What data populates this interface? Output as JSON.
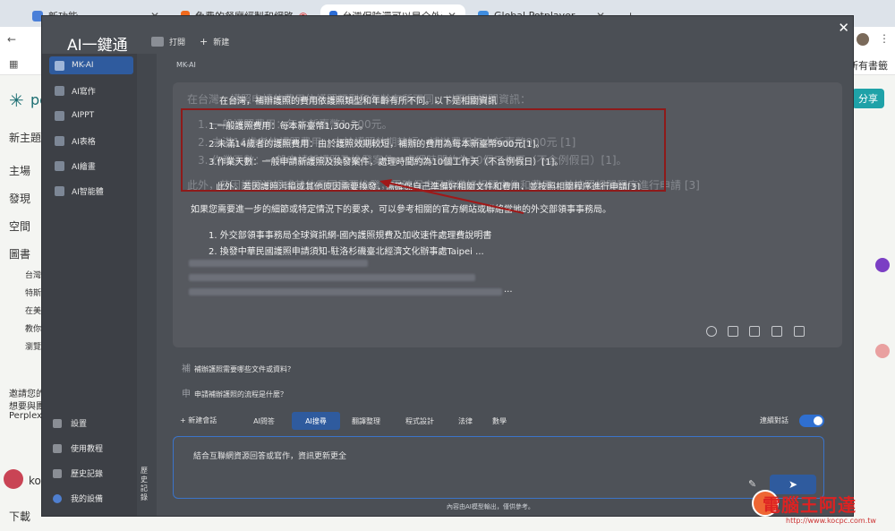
{
  "browser": {
    "tabs": [
      {
        "label": "新功能",
        "color": "#4a7fd8"
      },
      {
        "label": "免費的餐廳經製和網路操作",
        "color": "#f06a1d"
      },
      {
        "label": "台灣保險還可以是全外資公司嗎",
        "color": "#2b6cd6"
      },
      {
        "label": "Global Potplayer",
        "color": "#3f8de0"
      }
    ],
    "new_tab": "+",
    "bookmarks_right": "所有書籤",
    "share": "分享",
    "left_items": [
      "新主題",
      "主場",
      "發現",
      "空間",
      "圖書",
      "台灣",
      "特斯",
      "在美",
      "教你",
      "瀏覽"
    ],
    "left_footer": [
      "邀請您的",
      "想要與團",
      "Perplexity"
    ],
    "left_bottom": "下載",
    "left_user": "ko"
  },
  "watermark": {
    "text": "電腦王阿達",
    "url": "http://www.kocpc.com.tw"
  },
  "popup": {
    "title": "AI一鍵通",
    "close": "✕",
    "top_buttons": [
      "打開",
      "新建"
    ],
    "sidebar": [
      {
        "label": "MK-AI",
        "active": true
      },
      {
        "label": "AI寫作",
        "active": false
      },
      {
        "label": "AIPPT",
        "active": false
      },
      {
        "label": "AI表格",
        "active": false
      },
      {
        "label": "AI繪畫",
        "active": false
      },
      {
        "label": "AI智能體",
        "active": false
      }
    ],
    "sidebar_bottom": [
      "設置",
      "使用教程",
      "歷史記錄",
      "我的設備"
    ],
    "history_vertical": "歷史記錄",
    "mk_label": "MK-AI",
    "answer": {
      "intro_under": "在台灣，護照申請的費用依護照類型和年齡有所不同，以下是相關資訊：",
      "intro": "在台灣，補辦護照的費用依護照類型和年齡有所不同。以下是相關資訊",
      "items": [
        {
          "num": "1.",
          "text": "一般護照費用：每本新臺幣1,300元。",
          "under": "1. 一般護照費用：每本新臺幣1,300元。"
        },
        {
          "num": "2.",
          "text": "未滿14歲者的護照費用：由於護照效期較短，補辦的費用為每本新臺幣900元[1]。",
          "under": "2. 未滿14歲者的護照費用：由於護照效期較短，補辦費用每本新臺幣900元 [1]"
        },
        {
          "num": "3.",
          "text": "作業天數：一般申請新護照及換發案件，處理時間約為10個工作天（不含例假日）[1]。",
          "under": "3. 作業天數：一般申請新護照及換發案件，處理時間約為10個工作天（不含例假日）[1]。"
        }
      ],
      "extra": "此外，若因護照污損或其他原因需要換發，需確保自己準備好相關文件和費用，並按照相關程序進行申請[3]",
      "extra_under": "此外，若因護照污損或其他原因需要換發，需確保自己準備好相關文件和費用，並按照相關程序進行申請 [3]",
      "followup": "如果您需要進一步的細節或特定情況下的要求，可以參考相關的官方網站或聯絡當地的外交部領事事務局。",
      "refs": [
        "1. 外交部領事事務局全球資訊網-國內護照規費及加收速件處理費說明書",
        "2. 換發中華民國護照申請須知-駐洛杉磯臺北經濟文化辦事處Taipei ..."
      ],
      "ref_ellipsis": "..."
    },
    "suggestions": [
      {
        "under": "補",
        "text": "補辦護照需要哪些文件或資料？"
      },
      {
        "under": "申",
        "text": "申請補辦護照的流程是什麼？"
      }
    ],
    "new_chat": "新建會話",
    "modes": [
      "AI問答",
      "AI搜尋",
      "翻譯整理",
      "程式設計",
      "法律",
      "數學"
    ],
    "active_mode": "AI搜尋",
    "toggle_label": "連續對話",
    "toggle_on": true,
    "input_placeholder": "結合互聯網資源回答或寫作，資訊更新更全",
    "disclaimer": "內容由AI模型輸出，僅供參考。"
  }
}
